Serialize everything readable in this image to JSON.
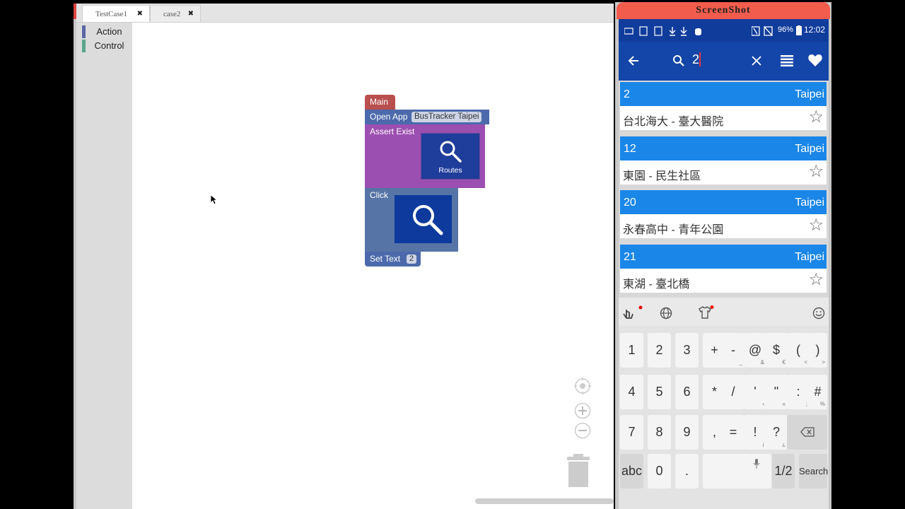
{
  "ide": {
    "tabs": [
      {
        "label": "TestCase1",
        "close": "✖"
      },
      {
        "label": "case2",
        "close": "✖"
      }
    ],
    "toolbox": [
      {
        "label": "Action",
        "color": "#5b68a6"
      },
      {
        "label": "Control",
        "color": "#5ba58c"
      }
    ],
    "blocks": {
      "main": "Main",
      "open_app": "Open App",
      "open_app_value": "BusTracker Taipei",
      "assert_exist": "Assert Exist",
      "routes_label": "Routes",
      "click": "Click",
      "set_text": "Set Text",
      "set_text_value": "2"
    }
  },
  "phone": {
    "title": "ScreenShot",
    "status": {
      "battery": "96%",
      "time": "12:02"
    },
    "search_query": "2",
    "routes": [
      {
        "num": "2",
        "city": "Taipei",
        "name": "台北海大 - 臺大醫院"
      },
      {
        "num": "12",
        "city": "Taipei",
        "name": "東園 - 民生社區"
      },
      {
        "num": "20",
        "city": "Taipei",
        "name": "永春高中 - 青年公園"
      },
      {
        "num": "21",
        "city": "Taipei",
        "name": "東湖 - 臺北橋"
      }
    ],
    "keyboard": {
      "row1": [
        {
          "k": "1"
        },
        {
          "k": "2"
        },
        {
          "k": "3"
        },
        {
          "k": "+"
        },
        {
          "k": "-",
          "s": "_"
        },
        {
          "k": "@",
          "s": "&"
        },
        {
          "k": "$",
          "s": "€"
        },
        {
          "k": "(",
          "s": "<"
        },
        {
          "k": ")",
          "s": ">"
        }
      ],
      "row2": [
        {
          "k": "4"
        },
        {
          "k": "5"
        },
        {
          "k": "6"
        },
        {
          "k": "*"
        },
        {
          "k": "/"
        },
        {
          "k": "'",
          "s": "‹"
        },
        {
          "k": "\"",
          "s": "«"
        },
        {
          "k": ":",
          "s": ";"
        },
        {
          "k": "#",
          "s": "%"
        }
      ],
      "row3": [
        {
          "k": "7"
        },
        {
          "k": "8"
        },
        {
          "k": "9"
        },
        {
          "k": ","
        },
        {
          "k": "="
        },
        {
          "k": "!",
          "s": "¡"
        },
        {
          "k": "?",
          "s": "¿"
        }
      ],
      "abc": "abc",
      "zero": "0",
      "dot": ".",
      "page": "1/2",
      "search": "Search"
    }
  }
}
